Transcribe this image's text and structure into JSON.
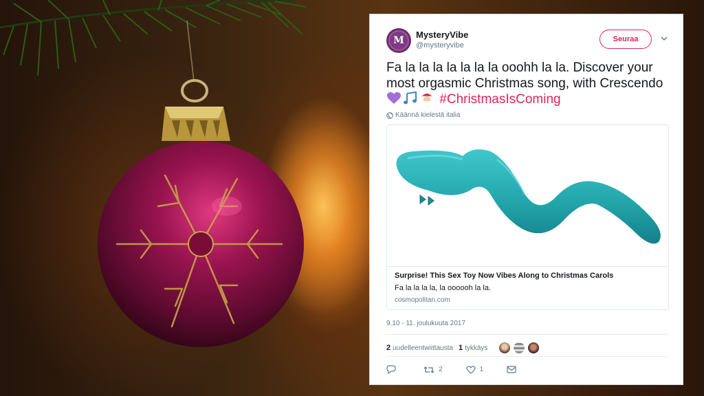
{
  "tweet": {
    "display_name": "MysteryVibe",
    "handle": "@mysteryvibe",
    "avatar_letter": "M",
    "follow_label": "Seuraa",
    "text_before_emoji": "Fa la la la la la la la ooohh la la. Discover your most orgasmic Christmas song, with Crescendo",
    "emojis": [
      "purple-heart-icon",
      "musical-notes-icon",
      "santa-icon"
    ],
    "hashtag": "#ChristmasIsComing",
    "translate_label": "Käännä kielestä italia",
    "card": {
      "title": "Surprise! This Sex Toy Now Vibes Along to Christmas Carols",
      "description": "Fa la la la la, la oooooh la la.",
      "domain": "cosmopolitan.com"
    },
    "timestamp": "9.10 - 11. joulukuuta 2017",
    "stats": {
      "retweets_count": "2",
      "retweets_label": "uudelleentwiittausta",
      "likes_count": "1",
      "likes_label": "tykkäys"
    },
    "actions": {
      "reply_count": "",
      "retweet_count": "2",
      "like_count": "1"
    }
  },
  "colors": {
    "accent": "#e0245e",
    "muted": "#657786",
    "text": "#14171a",
    "product": "#2bb3b8"
  }
}
